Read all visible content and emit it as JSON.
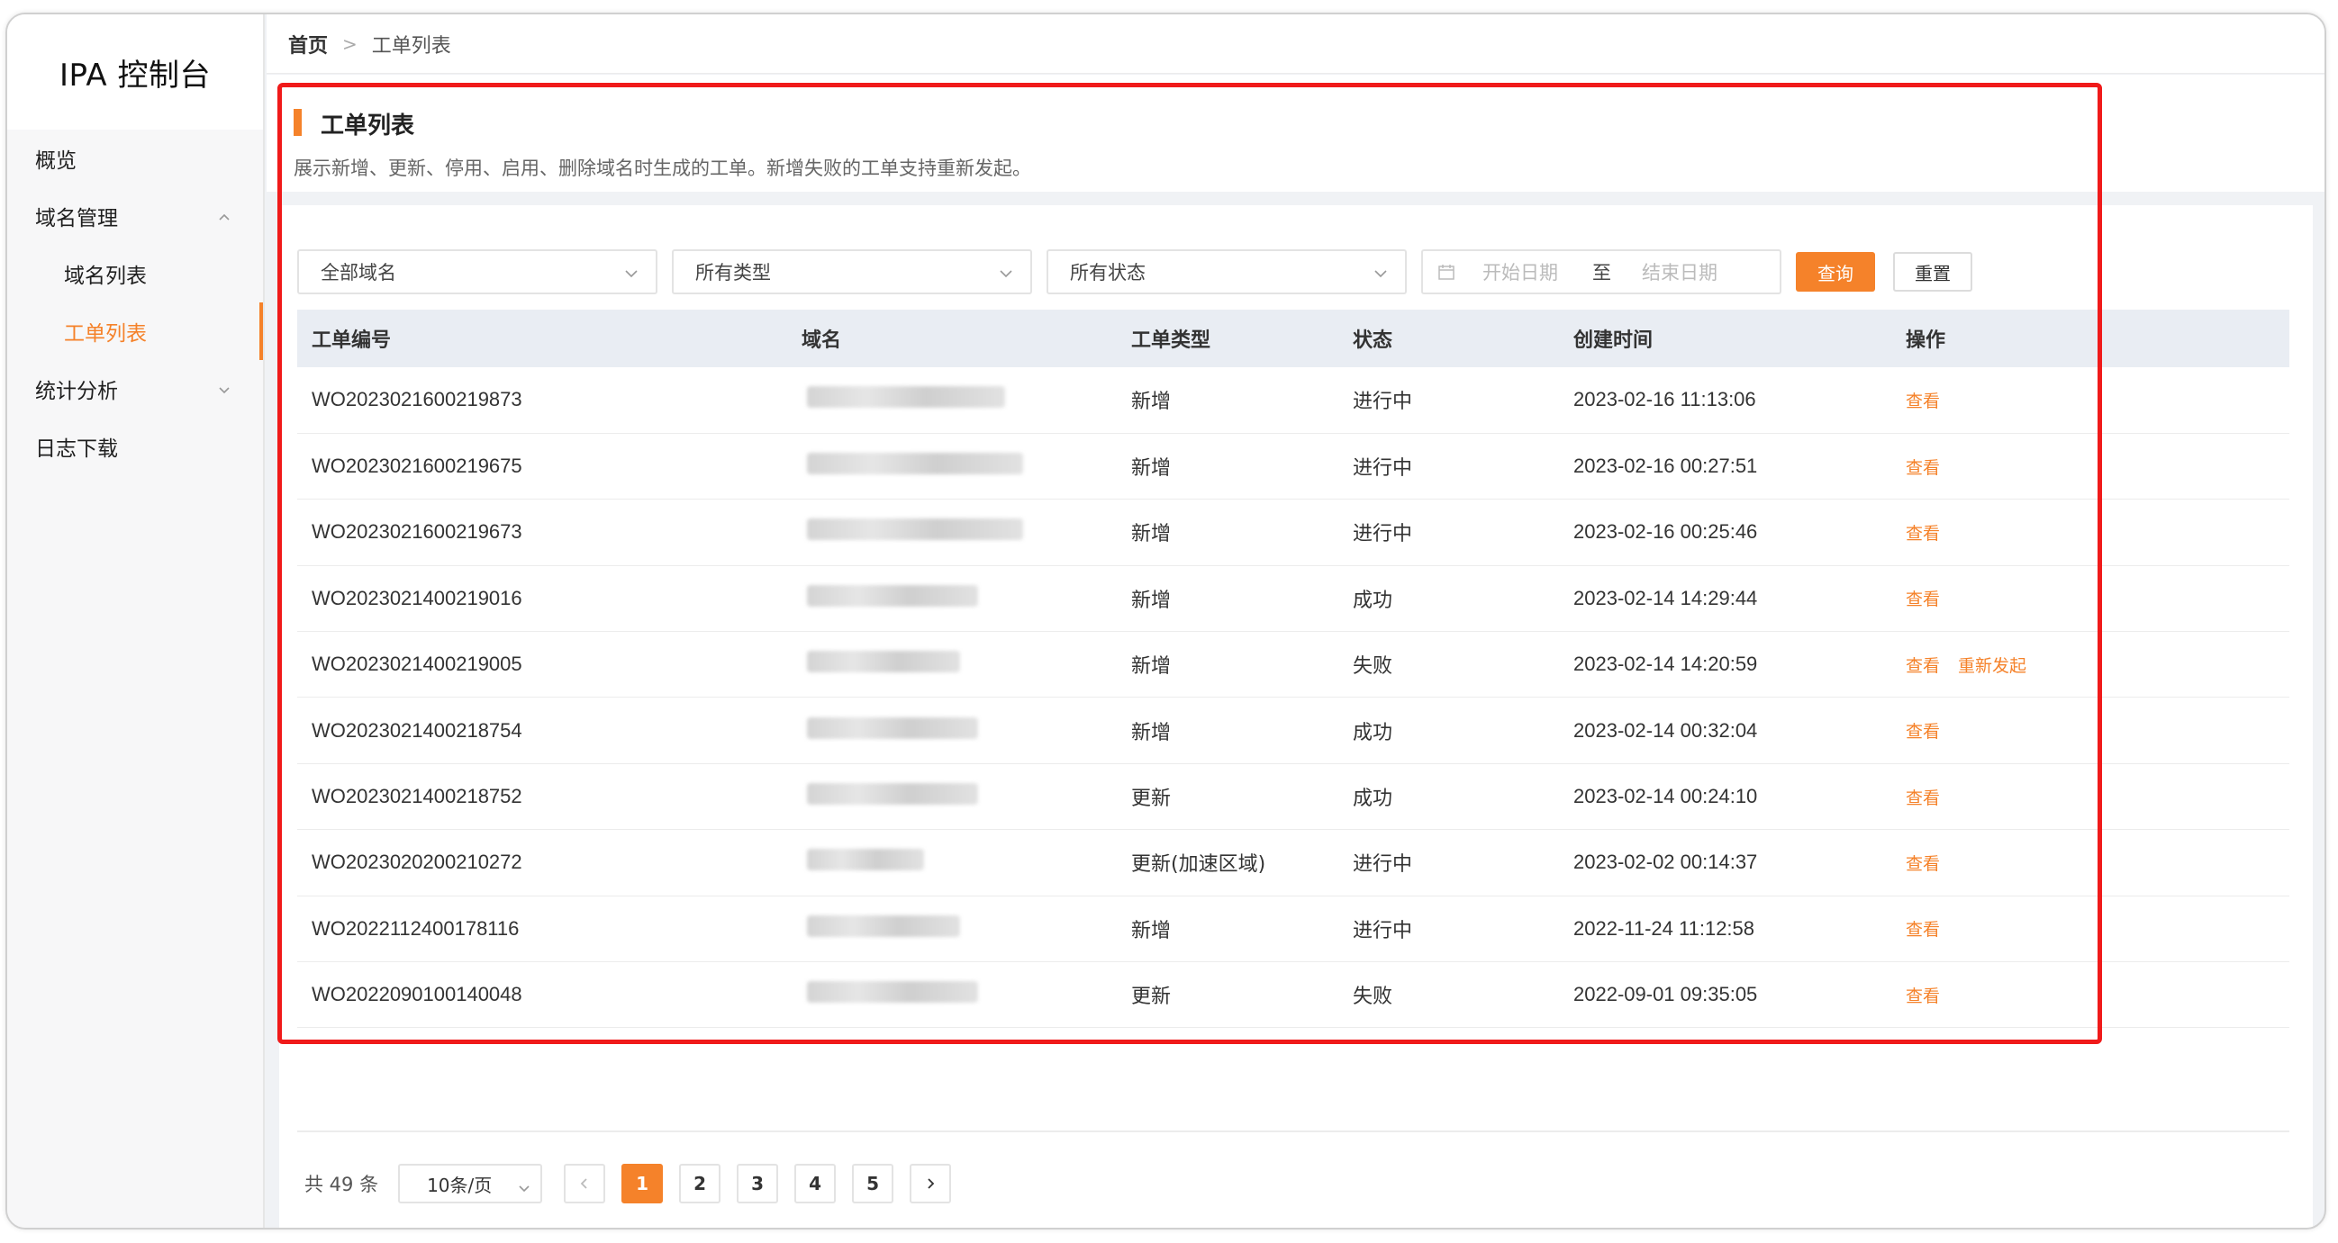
{
  "app": {
    "title": "IPA 控制台"
  },
  "sidebar": {
    "items": [
      {
        "label": "概览"
      },
      {
        "label": "域名管理"
      },
      {
        "label": "域名列表"
      },
      {
        "label": "工单列表"
      },
      {
        "label": "统计分析"
      },
      {
        "label": "日志下载"
      }
    ],
    "accent_color": "#f5822a"
  },
  "breadcrumb": {
    "home": "首页",
    "separator": ">",
    "current": "工单列表"
  },
  "page": {
    "title": "工单列表",
    "description": "展示新增、更新、停用、启用、删除域名时生成的工单。新增失败的工单支持重新发起。"
  },
  "filters": {
    "domain_select": "全部域名",
    "type_select": "所有类型",
    "status_select": "所有状态",
    "start_placeholder": "开始日期",
    "to_label": "至",
    "end_placeholder": "结束日期",
    "query_label": "查询",
    "reset_label": "重置"
  },
  "table": {
    "headers": [
      "工单编号",
      "域名",
      "工单类型",
      "状态",
      "创建时间",
      "操作"
    ],
    "rows": [
      {
        "id": "WO2023021600219873",
        "type": "新增",
        "status": "进行中",
        "status_kind": "progress",
        "created": "2023-02-16 11:13:06",
        "actions": [
          "查看"
        ]
      },
      {
        "id": "WO2023021600219675",
        "type": "新增",
        "status": "进行中",
        "status_kind": "progress",
        "created": "2023-02-16 00:27:51",
        "actions": [
          "查看"
        ]
      },
      {
        "id": "WO2023021600219673",
        "type": "新增",
        "status": "进行中",
        "status_kind": "progress",
        "created": "2023-02-16 00:25:46",
        "actions": [
          "查看"
        ]
      },
      {
        "id": "WO2023021400219016",
        "type": "新增",
        "status": "成功",
        "status_kind": "success",
        "created": "2023-02-14 14:29:44",
        "actions": [
          "查看"
        ]
      },
      {
        "id": "WO2023021400219005",
        "type": "新增",
        "status": "失败",
        "status_kind": "fail",
        "created": "2023-02-14 14:20:59",
        "actions": [
          "查看",
          "重新发起"
        ]
      },
      {
        "id": "WO2023021400218754",
        "type": "新增",
        "status": "成功",
        "status_kind": "success",
        "created": "2023-02-14 00:32:04",
        "actions": [
          "查看"
        ]
      },
      {
        "id": "WO2023021400218752",
        "type": "更新",
        "status": "成功",
        "status_kind": "success",
        "created": "2023-02-14 00:24:10",
        "actions": [
          "查看"
        ]
      },
      {
        "id": "WO2023020200210272",
        "type": "更新(加速区域)",
        "status": "进行中",
        "status_kind": "progress",
        "created": "2023-02-02 00:14:37",
        "actions": [
          "查看"
        ]
      },
      {
        "id": "WO2022112400178116",
        "type": "新增",
        "status": "进行中",
        "status_kind": "progress",
        "created": "2022-11-24 11:12:58",
        "actions": [
          "查看"
        ]
      },
      {
        "id": "WO2022090100140048",
        "type": "更新",
        "status": "失败",
        "status_kind": "fail",
        "created": "2022-09-01 09:35:05",
        "actions": [
          "查看"
        ]
      }
    ]
  },
  "pagination": {
    "total_label": "共 49 条",
    "page_size": "10条/页",
    "pages": [
      "1",
      "2",
      "3",
      "4",
      "5"
    ],
    "current_page": "1"
  },
  "status_colors": {
    "progress": "#1e88e5",
    "success": "#2e9e4e",
    "fail": "#ef4b4b"
  },
  "highlight_color": "#f01a1a"
}
